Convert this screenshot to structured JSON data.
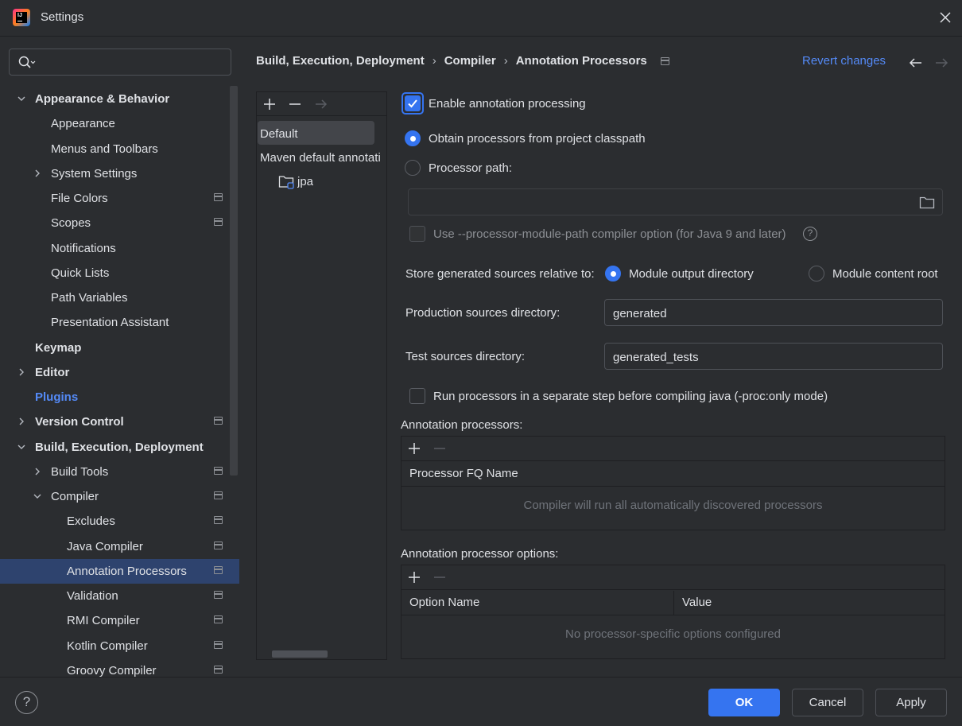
{
  "window": {
    "title": "Settings"
  },
  "search": {
    "placeholder": "",
    "value": ""
  },
  "tree": [
    {
      "label": "Appearance & Behavior",
      "bold": true,
      "expanded": true
    },
    {
      "label": "Appearance"
    },
    {
      "label": "Menus and Toolbars"
    },
    {
      "label": "System Settings",
      "collapsed": true
    },
    {
      "label": "File Colors"
    },
    {
      "label": "Scopes"
    },
    {
      "label": "Notifications"
    },
    {
      "label": "Quick Lists"
    },
    {
      "label": "Path Variables"
    },
    {
      "label": "Presentation Assistant"
    },
    {
      "label": "Keymap",
      "bold": true
    },
    {
      "label": "Editor",
      "bold": true,
      "collapsed": true
    },
    {
      "label": "Plugins",
      "link": true
    },
    {
      "label": "Version Control",
      "bold": true,
      "collapsed": true
    },
    {
      "label": "Build, Execution, Deployment",
      "bold": true,
      "expanded": true
    },
    {
      "label": "Build Tools",
      "collapsed": true
    },
    {
      "label": "Compiler",
      "expanded": true
    },
    {
      "label": "Excludes"
    },
    {
      "label": "Java Compiler"
    },
    {
      "label": "Annotation Processors",
      "selected": true
    },
    {
      "label": "Validation"
    },
    {
      "label": "RMI Compiler"
    },
    {
      "label": "Kotlin Compiler"
    },
    {
      "label": "Groovy Compiler"
    }
  ],
  "breadcrumb": {
    "items": [
      "Build, Execution, Deployment",
      "Compiler",
      "Annotation Processors"
    ],
    "separator": "›"
  },
  "revert_label": "Revert changes",
  "profiles": {
    "default": "Default",
    "maven": "Maven default annotati",
    "jpa": "jpa"
  },
  "form": {
    "enable_label": "Enable annotation processing",
    "obtain_label": "Obtain processors from project classpath",
    "processor_path_label": "Processor path:",
    "processor_path_value": "",
    "module_path_label": "Use --processor-module-path compiler option (for Java 9 and later)",
    "store_label": "Store generated sources relative to:",
    "module_output_label": "Module output directory",
    "module_content_label": "Module content root",
    "prod_label": "Production sources directory:",
    "prod_value": "generated",
    "test_label": "Test sources directory:",
    "test_value": "generated_tests",
    "run_sep_label": "Run processors in a separate step before compiling java (-proc:only mode)",
    "help_glyph": "?"
  },
  "processors_table": {
    "title": "Annotation processors:",
    "column": "Processor FQ Name",
    "empty": "Compiler will run all automatically discovered processors"
  },
  "options_table": {
    "title": "Annotation processor options:",
    "col_name": "Option Name",
    "col_value": "Value",
    "empty": "No processor-specific options configured"
  },
  "buttons": {
    "ok": "OK",
    "cancel": "Cancel",
    "apply": "Apply",
    "help": "?"
  },
  "colors": {
    "accent": "#3574f0",
    "link": "#548af7",
    "background": "#2b2d30",
    "selection": "#2e436e"
  }
}
